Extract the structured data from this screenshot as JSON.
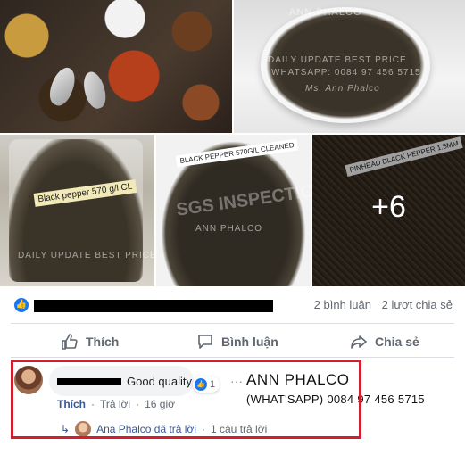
{
  "photos": {
    "photo2_watermark": "DAILY UPDATE BEST PRICE",
    "photo2_whatsapp": "WHATSAPP: 0084 97 456 5715",
    "photo2_sig": "Ms. Ann Phalco",
    "photo2_brand": "ANN PHALCO",
    "photo3_label": "Black pepper 570 g/l CL",
    "photo3_watermark": "DAILY UPDATE BEST PRICE",
    "photo4_label": "BLACK PEPPER 570G/L CLEANED",
    "photo4_watermark": "SGS INSPECTION",
    "photo4_brand": "ANN PHALCO",
    "photo5_label": "PINHEAD BLACK PEPPER 1.5MM",
    "more_count": "+6"
  },
  "stats": {
    "comments": "2 bình luận",
    "shares": "2 lượt chia sẻ"
  },
  "actions": {
    "like": "Thích",
    "comment": "Bình luận",
    "share": "Chia sẻ"
  },
  "comment": {
    "text": "Good quality",
    "reaction_count": "1",
    "like": "Thích",
    "reply": "Trả lời",
    "time": "16 giờ",
    "reply_summary_name": "Ana Phalco đã trả lời",
    "reply_summary_count": "1 câu trả lời"
  },
  "overlay_text": {
    "company": "ANN PHALCO",
    "phone": "(WHAT'SAPP) 0084 97 456 5715"
  },
  "colors": {
    "accent": "#1877f2",
    "highlight_box": "#d11f2f"
  }
}
